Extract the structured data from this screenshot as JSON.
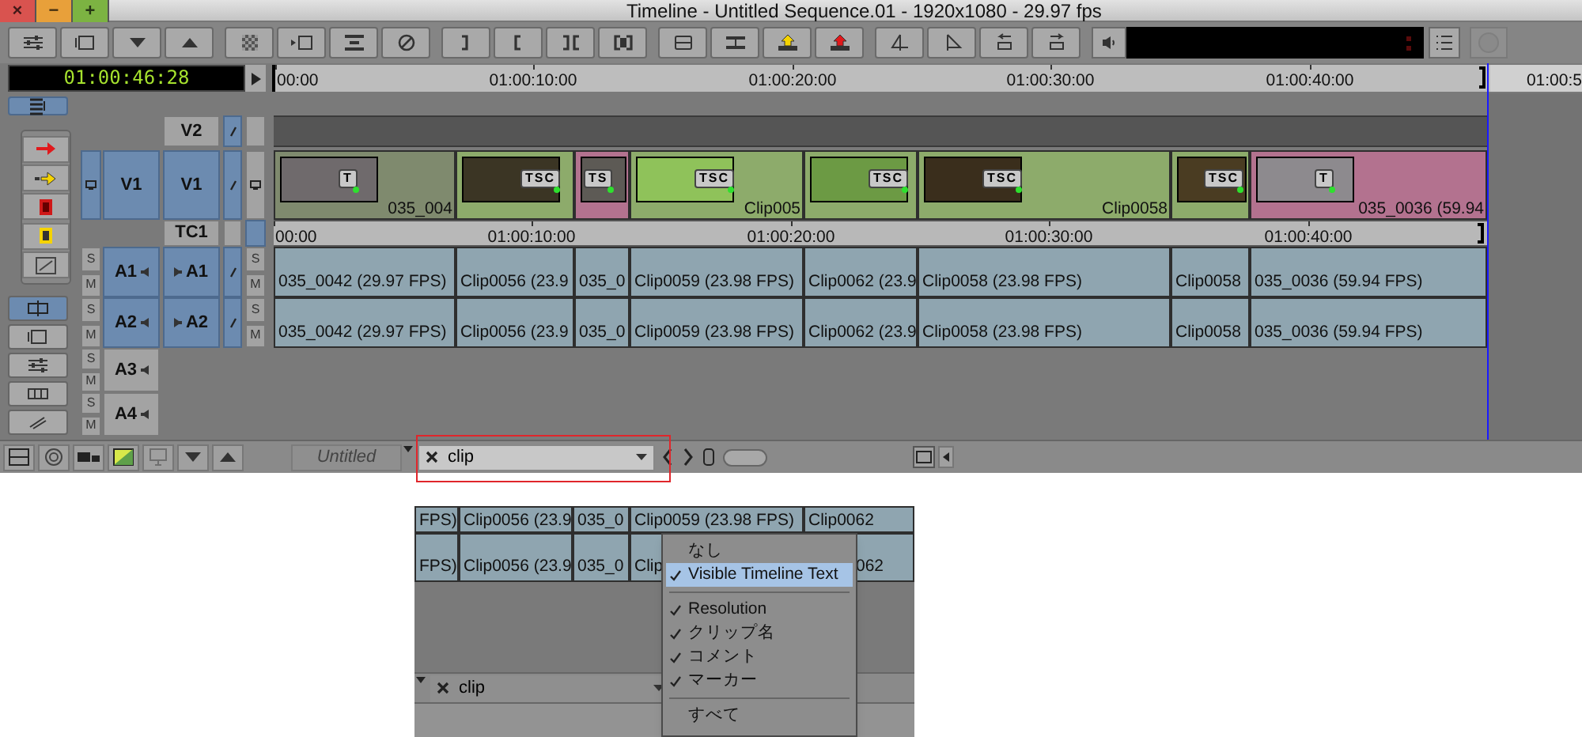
{
  "window": {
    "title": "Timeline - Untitled Sequence.01 - 1920x1080 - 29.97 fps",
    "controls": [
      {
        "label": "×",
        "color": "#d9534f"
      },
      {
        "label": "−",
        "color": "#e8a03a"
      },
      {
        "label": "+",
        "color": "#7cb342"
      }
    ]
  },
  "timecode": "01:00:46:28",
  "ruler": [
    "00:00",
    "01:00:10:00",
    "01:00:20:00",
    "01:00:30:00",
    "01:00:40:00",
    "01:00:5"
  ],
  "track_headers": [
    {
      "kind": "video",
      "record": "V2",
      "selected": false
    },
    {
      "kind": "video",
      "source": "V1",
      "record": "V1",
      "selected": true
    },
    {
      "kind": "timecode",
      "record": "TC1",
      "selected": false
    },
    {
      "kind": "audio",
      "source": "A1",
      "record": "A1",
      "selected": true,
      "source_buttons": [
        "S",
        "M"
      ],
      "record_buttons": [
        "S",
        "M"
      ]
    },
    {
      "kind": "audio",
      "source": "A2",
      "record": "A2",
      "selected": true,
      "source_buttons": [
        "S",
        "M"
      ],
      "record_buttons": [
        "S",
        "M"
      ]
    },
    {
      "kind": "audio",
      "source": "A3",
      "selected": false,
      "source_buttons": [
        "S",
        "M"
      ]
    },
    {
      "kind": "audio",
      "source": "A4",
      "selected": false,
      "source_buttons": [
        "S",
        "M"
      ]
    }
  ],
  "video_clips": [
    {
      "name": "035_004",
      "badge": "T",
      "color": "#7f8a6e"
    },
    {
      "badge": "TSC",
      "color": "#8dab6b"
    },
    {
      "badge": "TS",
      "color": "#b3728f"
    },
    {
      "name": "Clip005",
      "badge": "TSC",
      "color": "#8dab6b"
    },
    {
      "badge": "TSC",
      "color": "#8dab6b"
    },
    {
      "name": "Clip0058",
      "badge": "TSC",
      "color": "#8dab6b"
    },
    {
      "badge": "TSC",
      "color": "#8dab6b"
    },
    {
      "name": "035_0036 (59.94",
      "badge": "T",
      "color": "#b3728f"
    }
  ],
  "tc_ruler": [
    "00:00",
    "01:00:10:00",
    "01:00:20:00",
    "01:00:30:00",
    "01:00:40:00"
  ],
  "audio_tracks": [
    [
      "035_0042 (29.97 FPS)",
      "Clip0056 (23.9",
      "035_0",
      "Clip0059 (23.98 FPS)",
      "Clip0062 (23.9",
      "Clip0058 (23.98 FPS)",
      "Clip0058",
      "035_0036 (59.94 FPS)"
    ],
    [
      "035_0042 (29.97 FPS)",
      "Clip0056 (23.9",
      "035_0",
      "Clip0059 (23.98 FPS)",
      "Clip0062 (23.9",
      "Clip0058 (23.98 FPS)",
      "Clip0058",
      "035_0036 (59.94 FPS)"
    ]
  ],
  "bottom_bar": {
    "sequence": "Untitled",
    "search": "clip"
  },
  "inset": {
    "rows": [
      [
        "FPS)",
        "Clip0056 (23.9",
        "035_0",
        "Clip0059 (23.98 FPS)",
        "Clip0062"
      ],
      [
        "FPS)",
        "Clip0056 (23.9",
        "035_0",
        "Clip",
        "062"
      ]
    ],
    "search": "clip",
    "menu": [
      {
        "kind": "item",
        "label": "なし",
        "checked": false,
        "selected": false
      },
      {
        "kind": "item",
        "label": "Visible Timeline Text",
        "checked": true,
        "selected": true
      },
      {
        "kind": "separator"
      },
      {
        "kind": "item",
        "label": "Resolution",
        "checked": true,
        "selected": false
      },
      {
        "kind": "item",
        "label": "クリップ名",
        "checked": true,
        "selected": false
      },
      {
        "kind": "item",
        "label": "コメント",
        "checked": true,
        "selected": false
      },
      {
        "kind": "item",
        "label": "マーカー",
        "checked": true,
        "selected": false
      },
      {
        "kind": "separator"
      },
      {
        "kind": "item",
        "label": "すべて",
        "checked": false,
        "selected": false
      }
    ]
  }
}
